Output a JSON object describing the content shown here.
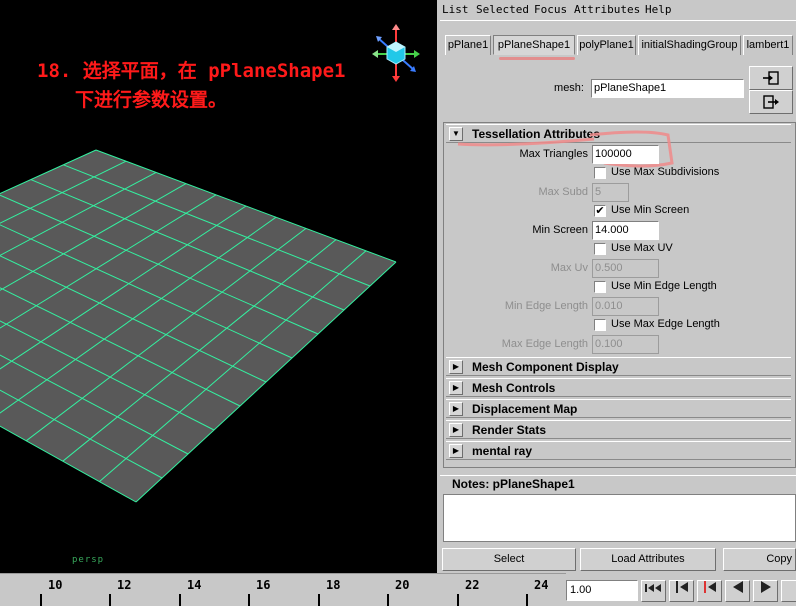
{
  "viewport": {
    "annotation_line1": "18. 选择平面，在 pPlaneShape1",
    "annotation_line2": "下进行参数设置。",
    "camera_label": "persp",
    "colors": {
      "background": "#000000",
      "plane_fill": "#595959",
      "wireframe": "#34f0a0",
      "annotation": "#ff1a1a"
    }
  },
  "menu": [
    "List",
    "Selected",
    "Focus",
    "Attributes",
    "Help"
  ],
  "tabs": [
    {
      "label": "pPlane1",
      "active": false
    },
    {
      "label": "pPlaneShape1",
      "active": true
    },
    {
      "label": "polyPlane1",
      "active": false
    },
    {
      "label": "initialShadingGroup",
      "active": false
    },
    {
      "label": "lambert1",
      "active": false
    }
  ],
  "mesh": {
    "label": "mesh:",
    "value": "pPlaneShape1"
  },
  "tessellation": {
    "title": "Tessellation Attributes",
    "max_triangles_label": "Max Triangles",
    "max_triangles_value": "100000",
    "use_max_subdivisions_label": "Use Max Subdivisions",
    "use_max_subdivisions_checked": false,
    "max_subd_label": "Max Subd",
    "max_subd_value": "5",
    "use_min_screen_label": "Use Min Screen",
    "use_min_screen_checked": true,
    "min_screen_label": "Min Screen",
    "min_screen_value": "14.000",
    "use_max_uv_label": "Use Max UV",
    "use_max_uv_checked": false,
    "max_uv_label": "Max Uv",
    "max_uv_value": "0.500",
    "use_min_edge_label": "Use Min Edge Length",
    "use_min_edge_checked": false,
    "min_edge_label": "Min Edge Length",
    "min_edge_value": "0.010",
    "use_max_edge_label": "Use Max Edge Length",
    "use_max_edge_checked": false,
    "max_edge_label": "Max Edge Length",
    "max_edge_value": "0.100"
  },
  "sections": [
    "Mesh Component Display",
    "Mesh Controls",
    "Displacement Map",
    "Render Stats",
    "mental ray"
  ],
  "notes": {
    "title": "Notes:  pPlaneShape1",
    "text": ""
  },
  "bottom_buttons": {
    "select": "Select",
    "load": "Load Attributes",
    "copy": "Copy"
  },
  "timeline": {
    "labels": [
      "10",
      "12",
      "14",
      "16",
      "18",
      "20",
      "22",
      "24"
    ],
    "current_frame": "1.00"
  },
  "playback_icons": [
    "skip-to-start-icon",
    "step-back-key-icon",
    "step-back-frame-icon",
    "play-backward-icon",
    "play-forward-icon"
  ]
}
